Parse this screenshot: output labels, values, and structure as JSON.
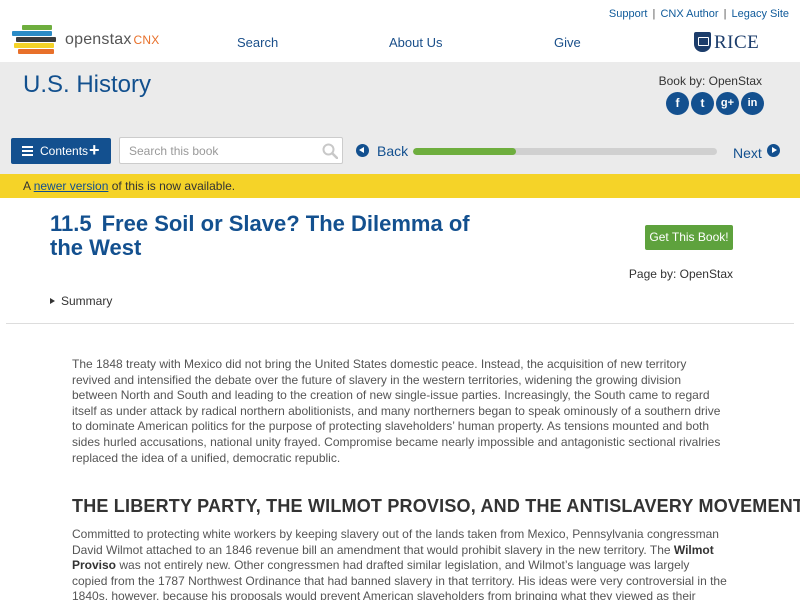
{
  "header": {
    "logo": {
      "brand": "openstax",
      "suffix": "CNX",
      "colors": [
        "#2b8bc6",
        "#6eae3e",
        "#e8702a",
        "#f5d328",
        "#3d3d3d"
      ]
    },
    "top_links": [
      "Support",
      "CNX Author",
      "Legacy Site"
    ],
    "nav": [
      "Search",
      "About Us",
      "Give"
    ],
    "partner_logo": "RICE"
  },
  "book": {
    "title": "U.S. History",
    "by": "Book by: OpenStax",
    "social": [
      {
        "icon": "facebook-icon",
        "glyph": "f"
      },
      {
        "icon": "twitter-icon",
        "glyph": "t"
      },
      {
        "icon": "google-plus-icon",
        "glyph": "g+"
      },
      {
        "icon": "linkedin-icon",
        "glyph": "in"
      }
    ],
    "contents_label": "Contents",
    "search_placeholder": "Search this book",
    "back_label": "Back",
    "next_label": "Next",
    "progress": 0.34
  },
  "notice": {
    "prefix": "A ",
    "link": "newer version",
    "suffix": " of this is now available."
  },
  "page": {
    "number": "11.5",
    "title": "Free Soil or Slave? The Dilemma of the West",
    "get_book": "Get This Book!",
    "by": "Page by: OpenStax",
    "summary": "Summary"
  },
  "content": {
    "intro": "The 1848 treaty with Mexico did not bring the United States domestic peace. Instead, the acquisition of new territory revived and intensified the debate over the future of slavery in the western territories, widening the growing division between North and South and leading to the creation of new single-issue parties. Increasingly, the South came to regard itself as under attack by radical northern abolitionists, and many northerners began to speak ominously of a southern drive to dominate American politics for the purpose of protecting slaveholders’ human property. As tensions mounted and both sides hurled accusations, national unity frayed. Compromise became nearly impossible and antagonistic sectional rivalries replaced the idea of a unified, democratic republic.",
    "section_heading": "THE LIBERTY PARTY, THE WILMOT PROVISO, AND THE ANTISLAVERY MOVEMENT",
    "p2_before": "Committed to protecting white workers by keeping slavery out of the lands taken from Mexico, Pennsylvania congressman David Wilmot attached to an 1846 revenue bill an amendment that would prohibit slavery in the new territory. The ",
    "p2_bold": "Wilmot Proviso",
    "p2_after": " was not entirely new. Other congressmen had drafted similar legislation, and Wilmot’s language was largely copied from the 1787 Northwest Ordinance that had banned slavery in that territory. His ideas were very controversial in the 1840s, however, because his proposals would prevent American slaveholders from bringing what they viewed as their lawful property, their slaves, into the western lands. The"
  }
}
